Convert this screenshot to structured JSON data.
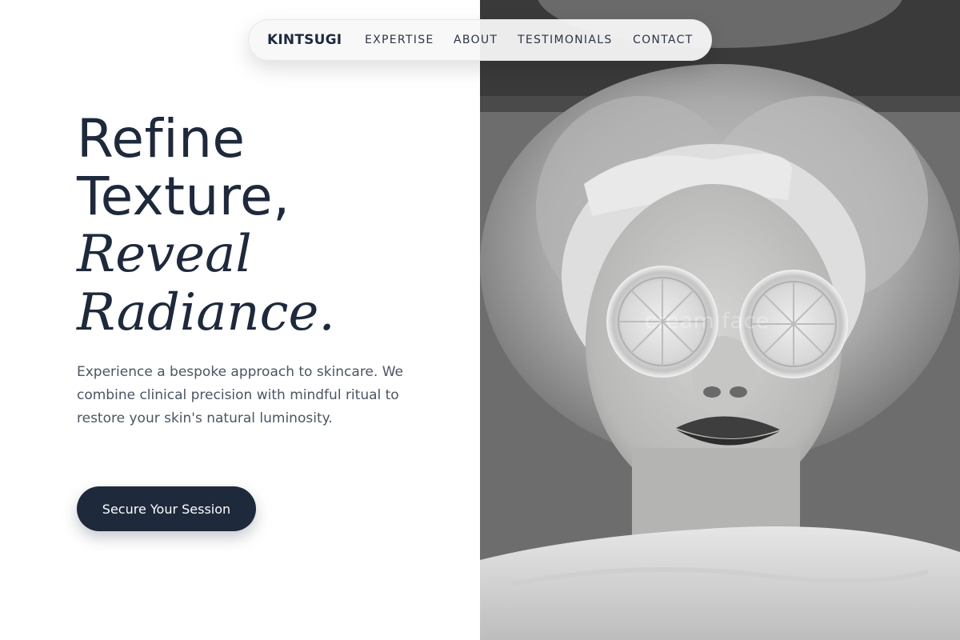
{
  "nav": {
    "brand": "KINTSUGI",
    "links": [
      "EXPERTISE",
      "ABOUT",
      "TESTIMONIALS",
      "CONTACT"
    ]
  },
  "hero": {
    "headline_line1": "Refine",
    "headline_line2": "Texture,",
    "headline_line3": "Reveal",
    "headline_line4": "Radiance.",
    "intro": "Experience a bespoke approach to skincare. We combine clinical precision with mindful ritual to restore your skin's natural luminosity.",
    "cta_label": "Secure Your Session"
  },
  "photo": {
    "watermark": "cream face",
    "style": "black-and-white"
  },
  "colors": {
    "primary": "#1e293b",
    "body_text": "#4b5563",
    "background": "#ffffff"
  }
}
